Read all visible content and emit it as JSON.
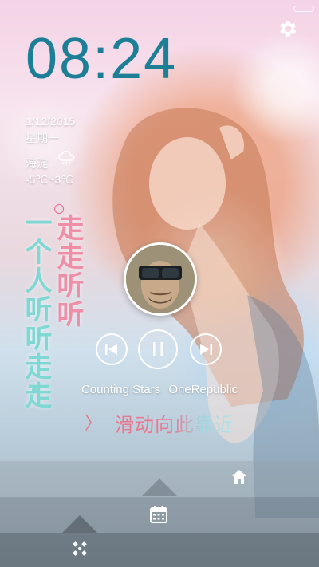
{
  "status": {
    "toggle_icon": "toggle-icon"
  },
  "header": {
    "settings_icon": "gear-icon"
  },
  "clock": {
    "time": "08:24",
    "date": "1/12/2015",
    "weekday": "星期一"
  },
  "weather": {
    "city": "海淀",
    "icon": "cloud-rain-icon",
    "temp": "-5℃~3℃"
  },
  "decor": {
    "lyrics_left": "一个人听听走走",
    "lyrics_right": "走走听听",
    "colors": {
      "teal": "#7fd8d4",
      "pink": "#ef8ea7",
      "clock": "#1c7f96"
    }
  },
  "player": {
    "album_icon": "album-art",
    "prev_icon": "previous-icon",
    "play_icon": "pause-icon",
    "next_icon": "next-icon",
    "song_title": "Counting Stars",
    "artist": "OneRepublic"
  },
  "unlock": {
    "arrow": "〉",
    "hint": "滑动向此靠近"
  },
  "dock": {
    "home_icon": "home-icon",
    "calendar_icon": "calendar-icon",
    "apps_icon": "apps-icon"
  }
}
